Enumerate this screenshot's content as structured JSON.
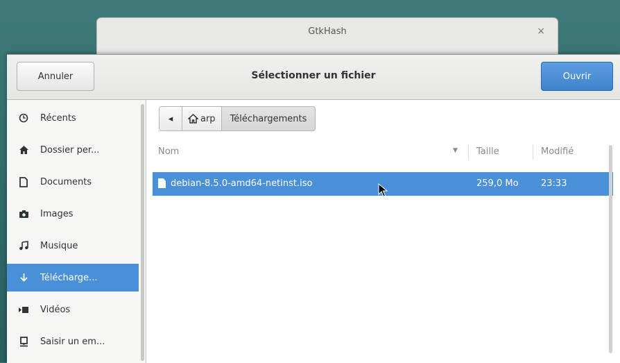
{
  "background_window": {
    "title": "GtkHash",
    "close_glyph": "×"
  },
  "dialog": {
    "title": "Sélectionner un fichier",
    "cancel_label": "Annuler",
    "open_label": "Ouvrir"
  },
  "sidebar": {
    "items": [
      {
        "label": "Récents",
        "icon": "clock-icon",
        "selected": false
      },
      {
        "label": "Dossier per...",
        "icon": "home-icon",
        "selected": false
      },
      {
        "label": "Documents",
        "icon": "document-icon",
        "selected": false
      },
      {
        "label": "Images",
        "icon": "camera-icon",
        "selected": false
      },
      {
        "label": "Musique",
        "icon": "music-icon",
        "selected": false
      },
      {
        "label": "Télécharge...",
        "icon": "download-icon",
        "selected": true
      },
      {
        "label": "Vidéos",
        "icon": "video-icon",
        "selected": false
      },
      {
        "label": "Saisir un em...",
        "icon": "location-icon",
        "selected": false
      }
    ]
  },
  "pathbar": {
    "back_glyph": "◂",
    "home_label": "arp",
    "current": "Téléchargements"
  },
  "columns": {
    "name": "Nom",
    "size": "Taille",
    "modified": "Modifié"
  },
  "files": [
    {
      "name": "debian-8.5.0-amd64-netinst.iso",
      "size": "259,0 Mo",
      "modified": "23:33",
      "selected": true
    }
  ],
  "colors": {
    "accent": "#4a90d9",
    "open_button": "#4a8fd6",
    "desktop": "#2f6a6a"
  }
}
